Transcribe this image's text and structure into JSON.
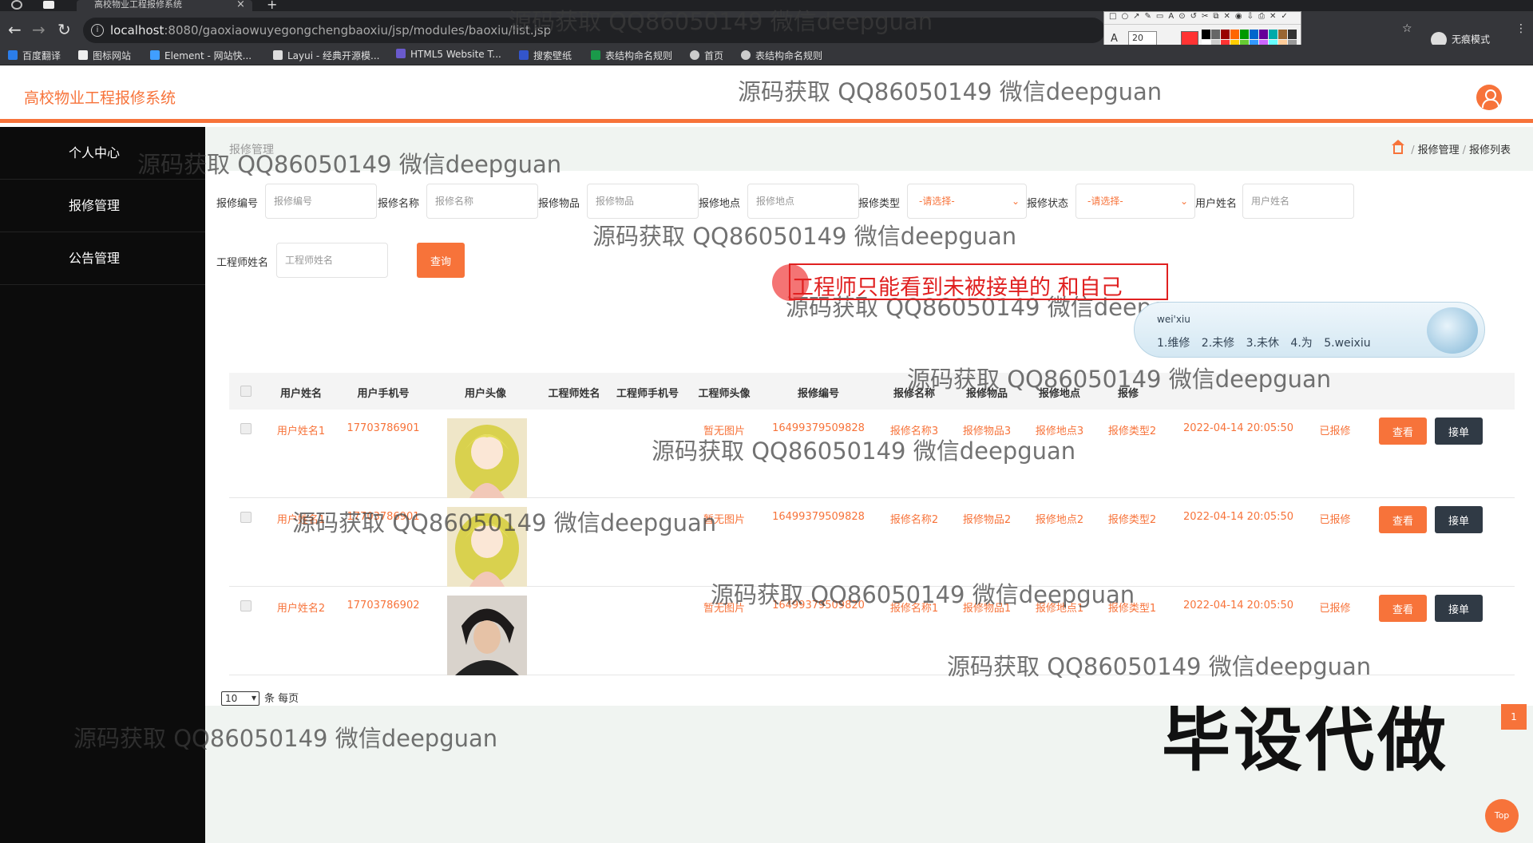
{
  "browser": {
    "tab_title": "高校物业工程报修系统",
    "url_host": "localhost",
    "url_path": ":8080/gaoxiaowuyegongchengbaoxiu/jsp/modules/baoxiu/list.jsp",
    "font_size_value": "20",
    "incognito_label": "无痕模式",
    "bookmarks": [
      "百度翻译",
      "图标网站",
      "Element - 网站快...",
      "Layui - 经典开源模...",
      "HTML5 Website T...",
      "搜索壁纸",
      "表结构命名规则",
      "首页",
      "表结构命名规则"
    ]
  },
  "header": {
    "title": "高校物业工程报修系统"
  },
  "sidebar": {
    "items": [
      {
        "label": "个人中心"
      },
      {
        "label": "报修管理"
      },
      {
        "label": "公告管理"
      }
    ]
  },
  "page": {
    "heading": "报修管理",
    "breadcrumb": [
      "报修管理",
      "报修列表"
    ]
  },
  "filters": {
    "repair_no": {
      "label": "报修编号",
      "placeholder": "报修编号"
    },
    "repair_name": {
      "label": "报修名称",
      "placeholder": "报修名称"
    },
    "repair_item": {
      "label": "报修物品",
      "placeholder": "报修物品"
    },
    "repair_place": {
      "label": "报修地点",
      "placeholder": "报修地点"
    },
    "repair_type": {
      "label": "报修类型",
      "value": "-请选择-"
    },
    "repair_status": {
      "label": "报修状态",
      "value": "-请选择-"
    },
    "user_name": {
      "label": "用户姓名",
      "placeholder": "用户姓名"
    },
    "engineer_name": {
      "label": "工程师姓名",
      "placeholder": "工程师姓名"
    },
    "query_label": "查询"
  },
  "table": {
    "columns": [
      "用户姓名",
      "用户手机号",
      "用户头像",
      "工程师姓名",
      "工程师手机号",
      "工程师头像",
      "报修编号",
      "报修名称",
      "报修物品",
      "报修地点",
      "报修"
    ],
    "rows": [
      {
        "user_name": "用户姓名1",
        "phone": "17703786901",
        "eng_avatar": "暂无图片",
        "repair_no": "16499379509828",
        "name": "报修名称3",
        "item": "报修物品3",
        "place": "报修地点3",
        "type": "报修类型2",
        "time": "2022-04-14 20:05:50",
        "status": "已报修",
        "view": "查看",
        "take": "接单"
      },
      {
        "user_name": "用户姓名1",
        "phone": "17703786901",
        "eng_avatar": "暂无图片",
        "repair_no": "16499379509828",
        "name": "报修名称2",
        "item": "报修物品2",
        "place": "报修地点2",
        "type": "报修类型2",
        "time": "2022-04-14 20:05:50",
        "status": "已报修",
        "view": "查看",
        "take": "接单"
      },
      {
        "user_name": "用户姓名2",
        "phone": "17703786902",
        "eng_avatar": "暂无图片",
        "repair_no": "16499379509820",
        "name": "报修名称1",
        "item": "报修物品1",
        "place": "报修地点1",
        "type": "报修类型1",
        "time": "2022-04-14 20:05:50",
        "status": "已报修",
        "view": "查看",
        "take": "接单"
      }
    ]
  },
  "pagination": {
    "page_size": "10",
    "per_page_label": "条 每页",
    "current_page": "1"
  },
  "top_button": "Top",
  "overlay": {
    "watermark": "源码获取 QQ86050149 微信deepguan",
    "annotation": "工程师只能看到未被接单的 和自己",
    "ime_pinyin": "wei'xiu",
    "ime_candidates": "1.维修 2.未修 3.未休 4.为 5.weixiu",
    "promo": "毕设代做"
  },
  "colors": {
    "accent": "#f7733a",
    "sidebar": "#0c0c0c",
    "dark_button": "#303a45"
  }
}
